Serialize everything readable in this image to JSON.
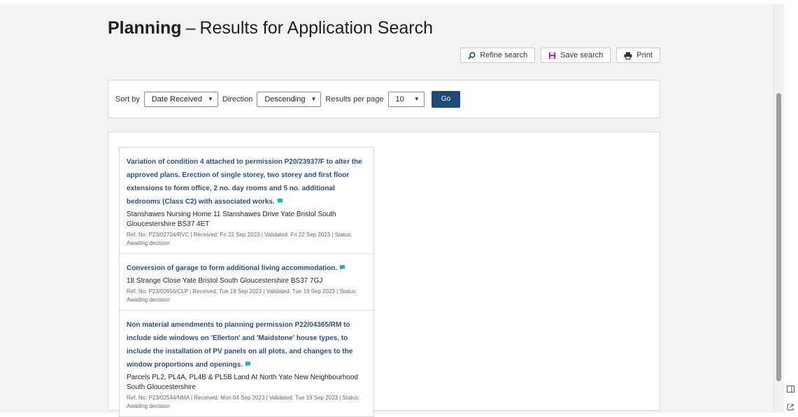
{
  "header": {
    "title_strong": "Planning",
    "separator": "–",
    "title_rest": "Results for Application Search"
  },
  "actions": {
    "refine": "Refine search",
    "save": "Save search",
    "print": "Print"
  },
  "sort": {
    "sort_by_label": "Sort by",
    "sort_by_value": "Date Received",
    "direction_label": "Direction",
    "direction_value": "Descending",
    "per_page_label": "Results per page",
    "per_page_value": "10",
    "go_label": "Go"
  },
  "results": [
    {
      "title": "Variation of condition 4 attached to permission P20/23937/F to alter the approved plans. Erection of single storey, two storey and first floor extensions to form office, 2 no. day rooms and 5 no. additional bedrooms (Class C2) with associated works.",
      "address": "Stanshawes Nursing Home 11 Stanshawes Drive Yate Bristol South Gloucestershire BS37 4ET",
      "meta": "Ref. No: P23/02704/RVC | Received: Fri 22 Sep 2023 | Validated: Fri 22 Sep 2023 | Status: Awaiting decision"
    },
    {
      "title": "Conversion of garage to form additional living accommodation.",
      "address": "18 Strange Close Yate Bristol South Gloucestershire BS37 7GJ",
      "meta": "Ref. No: P23/02656/CLP | Received: Tue 19 Sep 2023 | Validated: Tue 19 Sep 2023 | Status: Awaiting decision"
    },
    {
      "title": "Non material amendments to planning permission P22/04365/RM to include side windows on 'Ellerton' and 'Maidstone' house types, to include the installation of PV panels on all plots, and changes to the window proportions and openings.",
      "address": "Parcels PL2, PL4A, PL4B & PL5B Land At North Yate New Neighbourhood South Gloucestershire",
      "meta": "Ref. No: P23/02544/NMA | Received: Mon 04 Sep 2023 | Validated: Tue 19 Sep 2023 | Status: Awaiting decision"
    }
  ],
  "colors": {
    "link": "#2c4f7f",
    "go_button": "#1e4a7a",
    "comment_icon": "#2aa4e0",
    "save_icon": "#a0287a",
    "search_icon": "#1e4a7a"
  },
  "icons": {
    "refine": "search-icon",
    "save": "save-icon",
    "print": "print-icon",
    "comment": "comment-icon"
  }
}
